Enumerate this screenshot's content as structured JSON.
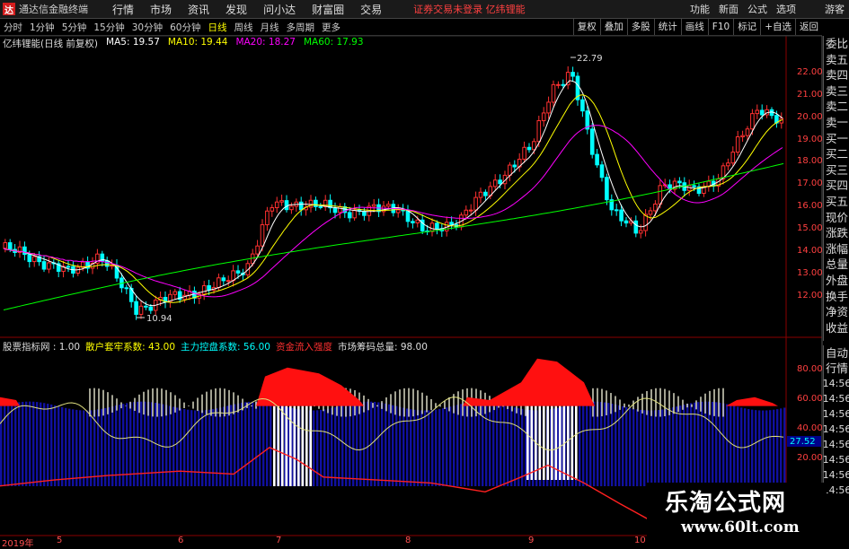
{
  "app": {
    "logo_char": "达",
    "title": "通达信金融终端"
  },
  "menu": [
    "行情",
    "市场",
    "资讯",
    "发现",
    "问小达",
    "财富圈",
    "交易"
  ],
  "notice": "证券交易未登录  亿纬锂能",
  "right_menu": [
    "功能",
    "新面",
    "公式",
    "选项",
    "游客"
  ],
  "periods": [
    "分时",
    "1分钟",
    "5分钟",
    "15分钟",
    "30分钟",
    "60分钟",
    "日线",
    "周线",
    "月线",
    "多周期",
    "更多"
  ],
  "active_period": "日线",
  "tools": [
    "复权",
    "叠加",
    "多股",
    "统计",
    "画线",
    "F10",
    "标记",
    "+自选",
    "返回"
  ],
  "main_legend": {
    "stock": "亿纬锂能(日线 前复权)",
    "ma5": "MA5: 19.57",
    "ma10": "MA10: 19.44",
    "ma20": "MA20: 18.27",
    "ma60": "MA60: 17.93"
  },
  "price_labels": [
    "22.00",
    "21.00",
    "20.00",
    "19.00",
    "18.00",
    "17.00",
    "16.00",
    "15.00",
    "14.00",
    "13.00",
    "12.00"
  ],
  "annotations": {
    "high": "22.79",
    "low": "10.94"
  },
  "side_panel": [
    "委比",
    "卖五",
    "卖四",
    "卖三",
    "卖二",
    "卖一",
    "买一",
    "买二",
    "买三",
    "买四",
    "买五",
    "现价",
    "涨跌",
    "涨幅",
    "总量",
    "外盘",
    "换手",
    "净资",
    "收益"
  ],
  "indicator_legend": {
    "name": "股票指标网 : 1.00",
    "a": "散户套牢系数: 43.00",
    "b": "主力控盘系数: 56.00",
    "c": "资金流入强度",
    "d": "市场筹码总量: 98.00"
  },
  "indicator_labels": [
    "80.00",
    "60.00",
    "40.00",
    "20.00"
  ],
  "indicator_value_box": "27.52",
  "side_panel2": [
    "自动",
    "行情",
    "14:56",
    "14:56",
    "14:56",
    "14:56",
    "14:56",
    "14:56",
    "14:56",
    "14:56"
  ],
  "x_axis": [
    "2019年",
    "5",
    "6",
    "7",
    "8",
    "9",
    "10"
  ],
  "watermark": {
    "title": "乐淘公式网",
    "url": "www.60lt.com"
  },
  "colors": {
    "up": "#ff3030",
    "down": "#00ffff",
    "ma5": "#ffffff",
    "ma10": "#ffff00",
    "ma20": "#ff00ff",
    "ma60": "#00ff00"
  }
}
